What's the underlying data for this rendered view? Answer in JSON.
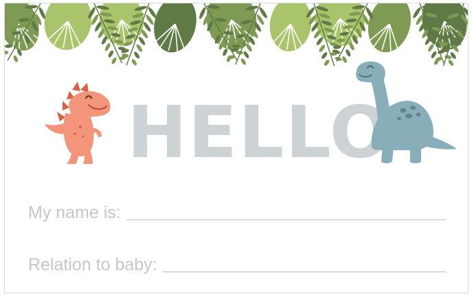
{
  "card": {
    "greeting": "HELLO",
    "fields": [
      {
        "label": "My name is:"
      },
      {
        "label": "Relation to baby:"
      }
    ]
  },
  "colors": {
    "greeting_text": "#cdd2d4",
    "field_text": "#c2c7ca",
    "leaf_light": "#a9c46a",
    "leaf_dark": "#5f7a44",
    "dino_orange": "#f2957a",
    "dino_blue": "#88aeb9"
  },
  "icons": [
    "tropical-leaves-border",
    "orange-dinosaur-icon",
    "blue-dinosaur-icon"
  ]
}
